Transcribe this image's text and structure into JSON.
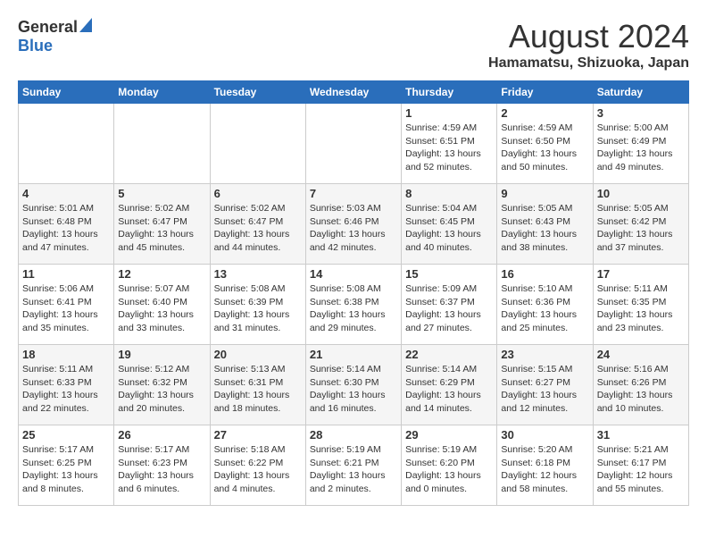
{
  "header": {
    "logo_general": "General",
    "logo_blue": "Blue",
    "month_year": "August 2024",
    "location": "Hamamatsu, Shizuoka, Japan"
  },
  "days_of_week": [
    "Sunday",
    "Monday",
    "Tuesday",
    "Wednesday",
    "Thursday",
    "Friday",
    "Saturday"
  ],
  "weeks": [
    [
      {
        "day": "",
        "info": ""
      },
      {
        "day": "",
        "info": ""
      },
      {
        "day": "",
        "info": ""
      },
      {
        "day": "",
        "info": ""
      },
      {
        "day": "1",
        "info": "Sunrise: 4:59 AM\nSunset: 6:51 PM\nDaylight: 13 hours\nand 52 minutes."
      },
      {
        "day": "2",
        "info": "Sunrise: 4:59 AM\nSunset: 6:50 PM\nDaylight: 13 hours\nand 50 minutes."
      },
      {
        "day": "3",
        "info": "Sunrise: 5:00 AM\nSunset: 6:49 PM\nDaylight: 13 hours\nand 49 minutes."
      }
    ],
    [
      {
        "day": "4",
        "info": "Sunrise: 5:01 AM\nSunset: 6:48 PM\nDaylight: 13 hours\nand 47 minutes."
      },
      {
        "day": "5",
        "info": "Sunrise: 5:02 AM\nSunset: 6:47 PM\nDaylight: 13 hours\nand 45 minutes."
      },
      {
        "day": "6",
        "info": "Sunrise: 5:02 AM\nSunset: 6:47 PM\nDaylight: 13 hours\nand 44 minutes."
      },
      {
        "day": "7",
        "info": "Sunrise: 5:03 AM\nSunset: 6:46 PM\nDaylight: 13 hours\nand 42 minutes."
      },
      {
        "day": "8",
        "info": "Sunrise: 5:04 AM\nSunset: 6:45 PM\nDaylight: 13 hours\nand 40 minutes."
      },
      {
        "day": "9",
        "info": "Sunrise: 5:05 AM\nSunset: 6:43 PM\nDaylight: 13 hours\nand 38 minutes."
      },
      {
        "day": "10",
        "info": "Sunrise: 5:05 AM\nSunset: 6:42 PM\nDaylight: 13 hours\nand 37 minutes."
      }
    ],
    [
      {
        "day": "11",
        "info": "Sunrise: 5:06 AM\nSunset: 6:41 PM\nDaylight: 13 hours\nand 35 minutes."
      },
      {
        "day": "12",
        "info": "Sunrise: 5:07 AM\nSunset: 6:40 PM\nDaylight: 13 hours\nand 33 minutes."
      },
      {
        "day": "13",
        "info": "Sunrise: 5:08 AM\nSunset: 6:39 PM\nDaylight: 13 hours\nand 31 minutes."
      },
      {
        "day": "14",
        "info": "Sunrise: 5:08 AM\nSunset: 6:38 PM\nDaylight: 13 hours\nand 29 minutes."
      },
      {
        "day": "15",
        "info": "Sunrise: 5:09 AM\nSunset: 6:37 PM\nDaylight: 13 hours\nand 27 minutes."
      },
      {
        "day": "16",
        "info": "Sunrise: 5:10 AM\nSunset: 6:36 PM\nDaylight: 13 hours\nand 25 minutes."
      },
      {
        "day": "17",
        "info": "Sunrise: 5:11 AM\nSunset: 6:35 PM\nDaylight: 13 hours\nand 23 minutes."
      }
    ],
    [
      {
        "day": "18",
        "info": "Sunrise: 5:11 AM\nSunset: 6:33 PM\nDaylight: 13 hours\nand 22 minutes."
      },
      {
        "day": "19",
        "info": "Sunrise: 5:12 AM\nSunset: 6:32 PM\nDaylight: 13 hours\nand 20 minutes."
      },
      {
        "day": "20",
        "info": "Sunrise: 5:13 AM\nSunset: 6:31 PM\nDaylight: 13 hours\nand 18 minutes."
      },
      {
        "day": "21",
        "info": "Sunrise: 5:14 AM\nSunset: 6:30 PM\nDaylight: 13 hours\nand 16 minutes."
      },
      {
        "day": "22",
        "info": "Sunrise: 5:14 AM\nSunset: 6:29 PM\nDaylight: 13 hours\nand 14 minutes."
      },
      {
        "day": "23",
        "info": "Sunrise: 5:15 AM\nSunset: 6:27 PM\nDaylight: 13 hours\nand 12 minutes."
      },
      {
        "day": "24",
        "info": "Sunrise: 5:16 AM\nSunset: 6:26 PM\nDaylight: 13 hours\nand 10 minutes."
      }
    ],
    [
      {
        "day": "25",
        "info": "Sunrise: 5:17 AM\nSunset: 6:25 PM\nDaylight: 13 hours\nand 8 minutes."
      },
      {
        "day": "26",
        "info": "Sunrise: 5:17 AM\nSunset: 6:23 PM\nDaylight: 13 hours\nand 6 minutes."
      },
      {
        "day": "27",
        "info": "Sunrise: 5:18 AM\nSunset: 6:22 PM\nDaylight: 13 hours\nand 4 minutes."
      },
      {
        "day": "28",
        "info": "Sunrise: 5:19 AM\nSunset: 6:21 PM\nDaylight: 13 hours\nand 2 minutes."
      },
      {
        "day": "29",
        "info": "Sunrise: 5:19 AM\nSunset: 6:20 PM\nDaylight: 13 hours\nand 0 minutes."
      },
      {
        "day": "30",
        "info": "Sunrise: 5:20 AM\nSunset: 6:18 PM\nDaylight: 12 hours\nand 58 minutes."
      },
      {
        "day": "31",
        "info": "Sunrise: 5:21 AM\nSunset: 6:17 PM\nDaylight: 12 hours\nand 55 minutes."
      }
    ]
  ]
}
